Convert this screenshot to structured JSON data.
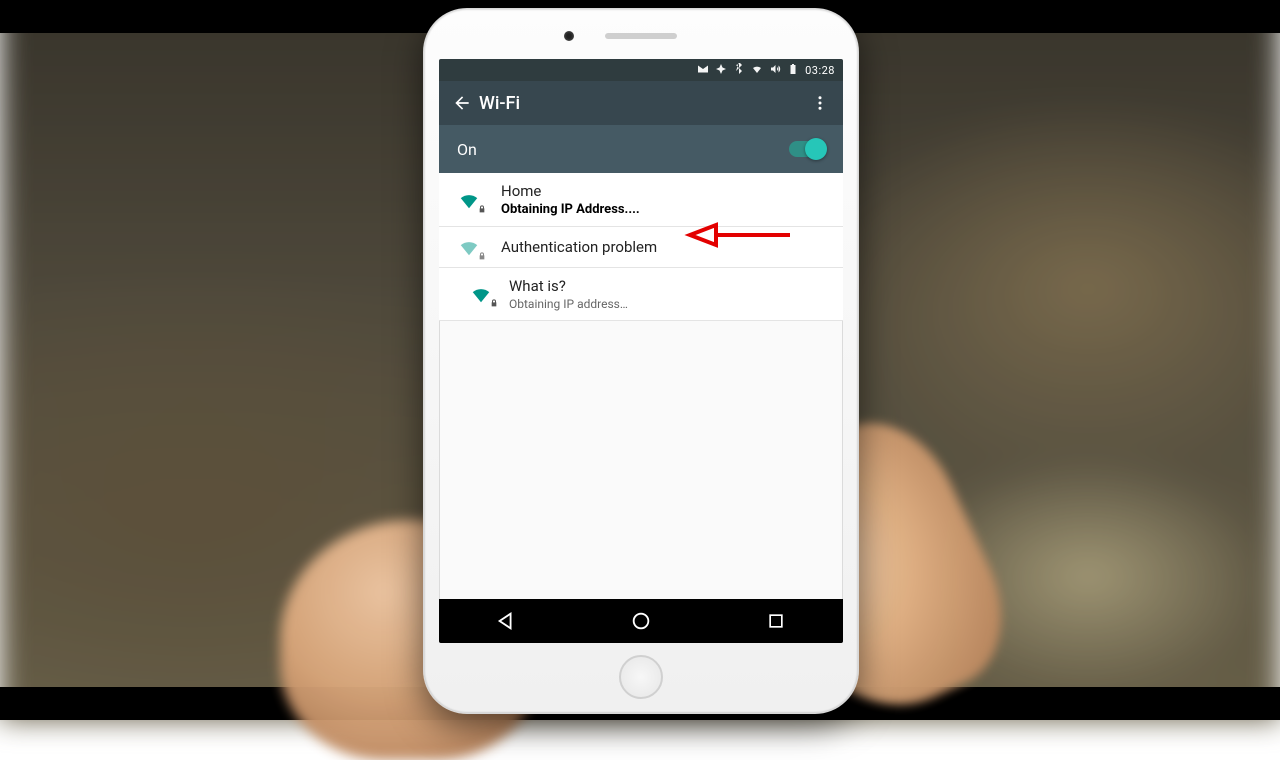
{
  "statusbar": {
    "time": "03:28"
  },
  "appbar": {
    "title": "Wi-Fi"
  },
  "toggle": {
    "label": "On",
    "state": true
  },
  "networks": [
    {
      "ssid": "Home",
      "status": "Obtaining IP Address....",
      "signal": "full",
      "secure": true
    },
    {
      "ssid": "Authentication problem",
      "status": "",
      "signal": "weak",
      "secure": true
    },
    {
      "ssid": "What is?",
      "status": "Obtaining IP address…",
      "signal": "full",
      "secure": true
    }
  ],
  "annotation": {
    "target": "networks.0.status"
  }
}
